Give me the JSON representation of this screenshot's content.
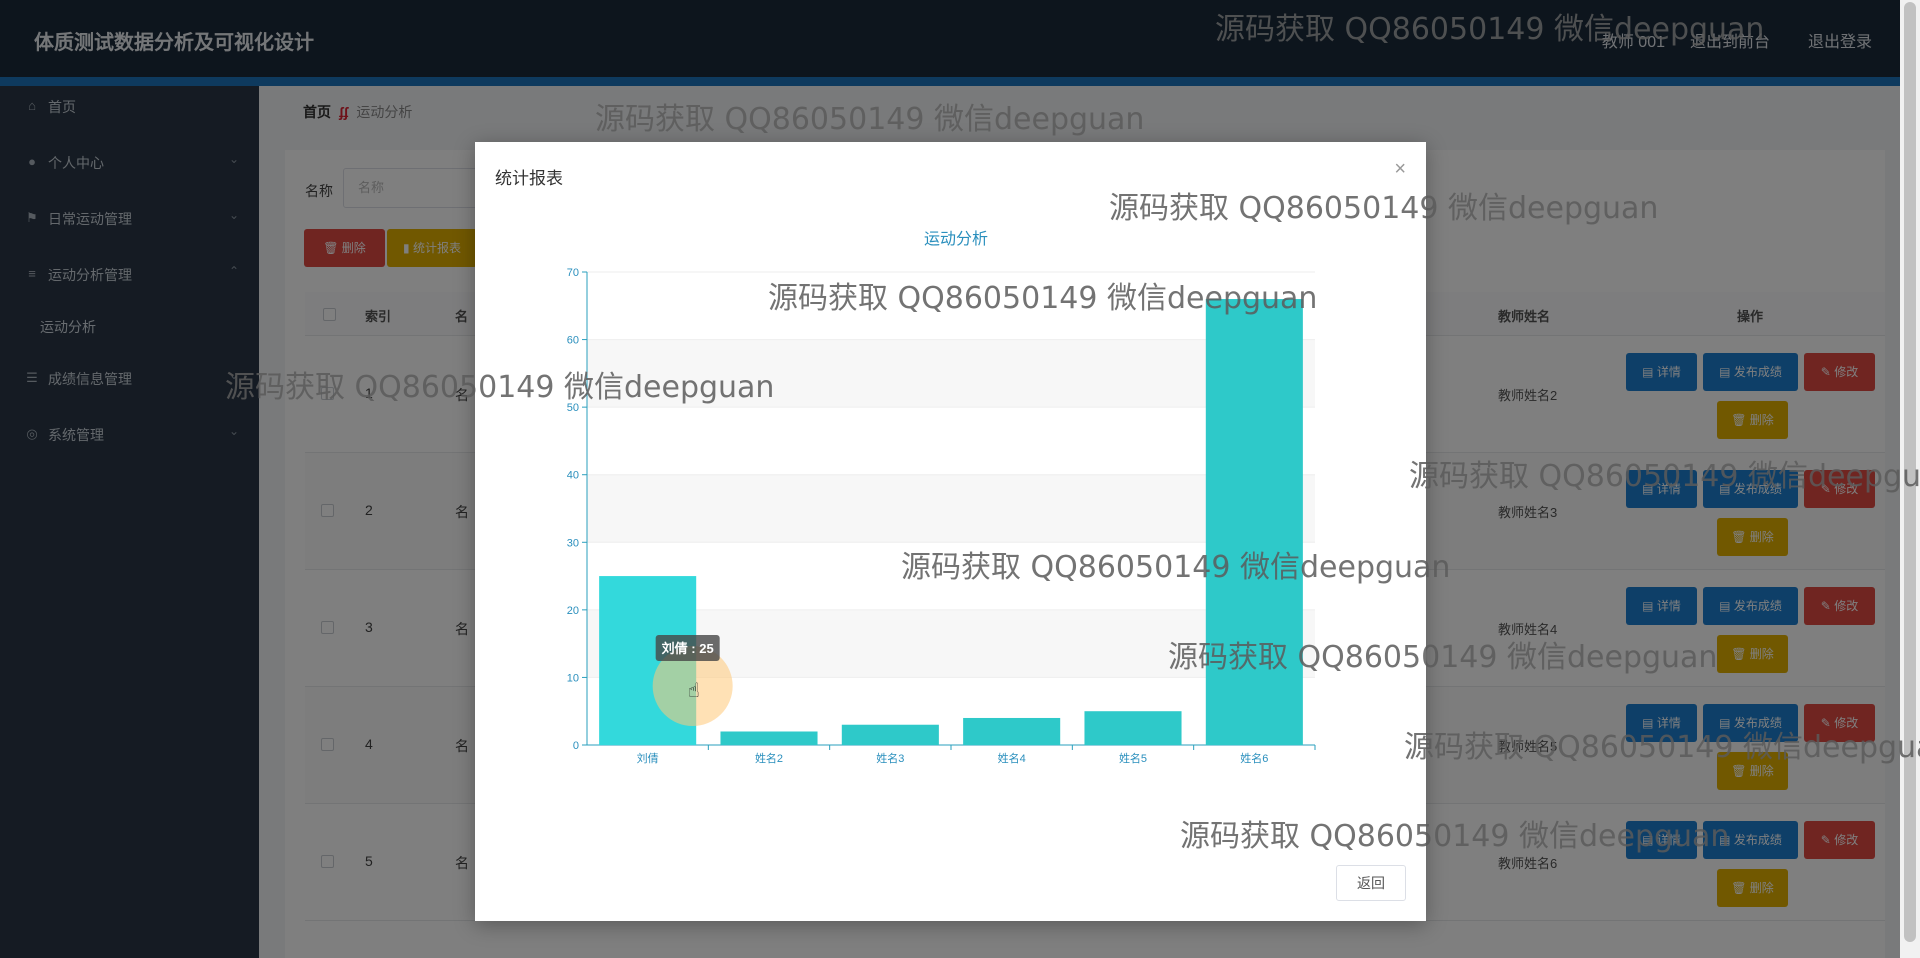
{
  "header": {
    "app_title": "体质测试数据分析及可视化设计",
    "user": "教师 001",
    "front": "退出到前台",
    "logout": "退出登录"
  },
  "sidebar": {
    "items": [
      {
        "label": "首页",
        "icon": "home-icon"
      },
      {
        "label": "个人中心",
        "icon": "user-icon",
        "chevron": "⌄"
      },
      {
        "label": "日常运动管理",
        "icon": "flag-icon",
        "chevron": "⌄"
      },
      {
        "label": "运动分析管理",
        "icon": "list-icon",
        "chevron": "⌃"
      },
      {
        "label": "成绩信息管理",
        "icon": "sliders-icon",
        "chevron": "⌄"
      },
      {
        "label": "系统管理",
        "icon": "settings-icon",
        "chevron": "⌄"
      }
    ],
    "sub_items": [
      {
        "label": "运动分析"
      }
    ]
  },
  "breadcrumb": {
    "home": "首页",
    "current": "运动分析"
  },
  "search": {
    "label": "名称",
    "placeholder": "名称"
  },
  "toolbar": {
    "delete_label": "删除",
    "stats_label": "统计报表"
  },
  "table": {
    "headers": {
      "index": "索引",
      "name": "名",
      "teacher": "教师姓名",
      "actions": "操作"
    },
    "rows": [
      {
        "index": "1",
        "name": "名",
        "teacher": "教师姓名2"
      },
      {
        "index": "2",
        "name": "名",
        "teacher": "教师姓名3"
      },
      {
        "index": "3",
        "name": "名",
        "teacher": "教师姓名4"
      },
      {
        "index": "4",
        "name": "名",
        "teacher": "教师姓名5"
      },
      {
        "index": "5",
        "name": "名",
        "teacher": "教师姓名6"
      }
    ],
    "action_labels": {
      "detail": "详情",
      "publish": "发布成绩",
      "edit": "修改",
      "delete": "删除"
    }
  },
  "modal": {
    "title": "统计报表",
    "close": "×",
    "back_label": "返回"
  },
  "chart_data": {
    "type": "bar",
    "title": "运动分析",
    "categories": [
      "刘倩",
      "姓名2",
      "姓名3",
      "姓名4",
      "姓名5",
      "姓名6"
    ],
    "values": [
      25,
      2,
      3,
      4,
      5,
      66
    ],
    "ylim": [
      0,
      70
    ],
    "yticks": [
      0,
      10,
      20,
      30,
      40,
      50,
      60,
      70
    ],
    "grid": true,
    "bar_color": "#2ec9c9",
    "tooltip": {
      "text": "刘倩 : 25"
    }
  },
  "watermark": "源码获取 QQ86050149 微信deepguan",
  "colors": {
    "header_bg": "#1b2a3a",
    "accent": "#1c75bc",
    "primary_btn": "#1c7fd1",
    "danger_btn": "#e04a43",
    "warning_btn": "#e2b100"
  }
}
